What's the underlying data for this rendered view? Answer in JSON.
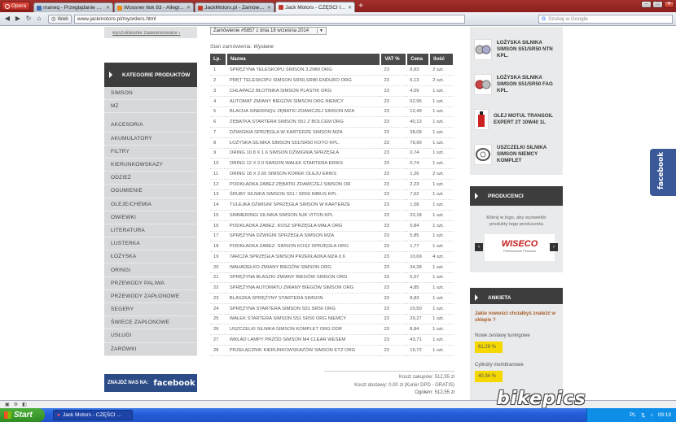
{
  "browser": {
    "menu_label": "Opera",
    "tabs": [
      {
        "title": "maneq - Przeglądanie pr...",
        "color": "#3b6db5",
        "active": false
      },
      {
        "title": "Wossner tłok 83 - Allegr...",
        "color": "#e88a16",
        "active": false
      },
      {
        "title": "JackMotors.pl - Zamówie...",
        "color": "#c0392b",
        "active": false
      },
      {
        "title": "Jack Motors - CZĘŚCI I A...",
        "color": "#c0392b",
        "active": true
      }
    ],
    "web_label": "Web",
    "url": "www.jackmotors.pl/myorders.html",
    "search_placeholder": "Szukaj w Google"
  },
  "left": {
    "advanced_search": "wyszukiwanie zaawansowane ›",
    "categories_header": "KATEGORIE PRODUKTÓW",
    "categories": [
      "SIMSON",
      "MZ",
      "AKCESORIA",
      "AKUMULATORY",
      "FILTRY",
      "KIERUNKOWSKAZY",
      "ODZIEŻ",
      "OGUMIENIE",
      "OLEJE/CHEMIA",
      "OWIEWKI",
      "LITERATURA",
      "LUSTERKA",
      "ŁOŻYSKA",
      "ORINGI",
      "PRZEWODY PALIWA",
      "PRZEWODY ZAPŁONOWE",
      "SEGERY",
      "ŚWIECE ZAPŁONOWE",
      "USŁUGI",
      "ŻARÓWKI"
    ],
    "facebook_prefix": "ZNAJDŹ NAS NA:",
    "facebook_brand": "facebook"
  },
  "order": {
    "select_value": "Zamówienie #5857 z dnia 18 września 2014",
    "status_label": "Stan zamówienia:",
    "status_value": "Wysłane",
    "headers": [
      "Lp.",
      "Nazwa",
      "VAT %",
      "Cena",
      "Ilość"
    ],
    "rows": [
      [
        "1",
        "Sprężyna teleskopu Simson 3,2mm ORG",
        "23",
        "8,83",
        "2 szt."
      ],
      [
        "2",
        "Pręt teleskopu Simson SR50,SR80 ENDURO ORG",
        "23",
        "6,13",
        "2 szt."
      ],
      [
        "3",
        "Chlapacz błotnika Simson plastik ORG",
        "23",
        "4,09",
        "1 szt."
      ],
      [
        "4",
        "Automat zmiany biegów Simson ORG NIEMCY",
        "23",
        "52,95",
        "1 szt."
      ],
      [
        "5",
        "Blacha sinerinqu zębatki zdawczej Simson MZA",
        "23",
        "12,49",
        "1 szt."
      ],
      [
        "6",
        "Zębatka startera Simson S51 z bolcem ORG",
        "23",
        "40,13",
        "1 szt."
      ],
      [
        "7",
        "Dźwignia sprzęgła w karterze Simson MZA",
        "23",
        "38,09",
        "1 szt."
      ],
      [
        "8",
        "Łożyska silnika Simson S51/SR50 KOYO KPL.",
        "23",
        "79,90",
        "1 szt."
      ],
      [
        "9",
        "Oring 10.8 x 1.6 Simson dźwignia sprzęgła",
        "23",
        "0,74",
        "1 szt."
      ],
      [
        "10",
        "Oring 12 x 2.0 Simson wałek startera ERIKS",
        "23",
        "0,74",
        "1 szt."
      ],
      [
        "11",
        "Oring 18 x 2.65 Simson korek oleju ERIKS",
        "23",
        "1,26",
        "2 szt."
      ],
      [
        "12",
        "Podkładka zabez.zębatki zdawczej Simson OR",
        "23",
        "2,23",
        "1 szt."
      ],
      [
        "13",
        "Śruby silnika Simson S51 / SR50 IMBUS KPL",
        "23",
        "7,62",
        "1 szt."
      ],
      [
        "14",
        "Tulejka dźwigni sprzęgła Simson w karterze",
        "23",
        "1,58",
        "1 szt."
      ],
      [
        "15",
        "Simmeringi silnika Simson NJK VITON KPL",
        "23",
        "23,18",
        "1 szt."
      ],
      [
        "16",
        "Podkładka zabez. kosz sprzęgła mała ORG",
        "23",
        "0,84",
        "1 szt."
      ],
      [
        "17",
        "Sprężyna dźwigni sprzęgła Simson MZA",
        "23",
        "5,85",
        "1 szt."
      ],
      [
        "18",
        "Podkładka zabez. Simson kosz sprzęgła ORG",
        "23",
        "1,77",
        "1 szt."
      ],
      [
        "19",
        "Tarcza sprzęgła Simson przekładka MZA 0.6",
        "23",
        "10,69",
        "4 szt."
      ],
      [
        "20",
        "Wahadełko zmiany biegów Simson ORG",
        "23",
        "34,28",
        "1 szt."
      ],
      [
        "21",
        "Sprężyna blaszki zmiany biegów Simson ORG",
        "23",
        "5,57",
        "1 szt."
      ],
      [
        "22",
        "Sprężyna automatu zmiany biegów Simson ORG",
        "23",
        "4,85",
        "1 szt."
      ],
      [
        "23",
        "Blaszka sprężyny startera Simson",
        "23",
        "8,83",
        "1 szt."
      ],
      [
        "24",
        "Sprężyna startera Simson S51 SR50 ORG",
        "23",
        "10,50",
        "1 szt."
      ],
      [
        "25",
        "Wałek startera Simson S51 SR50 ORG NIEMCY",
        "23",
        "29,27",
        "1 szt."
      ],
      [
        "26",
        "Uszczelki silnika Simson komplet ORG DDR",
        "23",
        "8,84",
        "1 szt."
      ],
      [
        "27",
        "Wkład lampy przód Simson M4 CLEAR WESEM",
        "23",
        "43,71",
        "1 szt."
      ],
      [
        "28",
        "Przełącznik kierunkowskazów Simson ETZ ORG",
        "23",
        "19,72",
        "1 szt."
      ]
    ],
    "totals": {
      "purchase": "Koszt zakupów: 512,55 zł",
      "delivery": "Koszt dostawy: 0,00 zł (Kurier DPD - GRATIS)",
      "total": "Ogółem: 512,55 zł"
    }
  },
  "right": {
    "products": [
      {
        "name": "ŁOŻYSKA SILNIKA SIMSON S51/SR50 NTN KPL.",
        "icon": "bearing-icon"
      },
      {
        "name": "ŁOŻYSKA SILNIKA SIMSON S51/SR50 FAG KPL.",
        "icon": "bearing-icon"
      },
      {
        "name": "OLEJ MOTUL TRANSOIL EXPERT 2T 10W40 1L",
        "icon": "oil-bottle-icon"
      },
      {
        "name": "USZCZELKI SILNIKA SIMSON NIEMCY KOMPLET",
        "icon": "gasket-icon"
      }
    ],
    "producers_header": "PRODUCENCI",
    "producers_text": "Kliknij w logo, aby wyświetlić produkty tego producenta",
    "producer_logo": "WISECO",
    "producer_logo_sub": "Performance Products",
    "poll_header": "ANKIETA",
    "poll_question": "Jakie nowości chciałbyś znaleźć w sklepie ?",
    "poll_options": [
      {
        "label": "Nowe zestawy tuningowe",
        "percent": "61,29 %"
      },
      {
        "label": "Cylindry membranowe",
        "percent": "40,34 %"
      }
    ],
    "facebook_tab": "facebook"
  },
  "watermark": "bikepics",
  "taskbar": {
    "start": "Start",
    "item": "Jack Motors - CZĘŚCI ...",
    "lang": "PL",
    "time": "09:19"
  },
  "colors": {
    "dark_header": "#3d3d3d",
    "sidebar": "#d6d8d9",
    "facebook": "#2b4c86",
    "poll_bar": "#f5d800"
  }
}
